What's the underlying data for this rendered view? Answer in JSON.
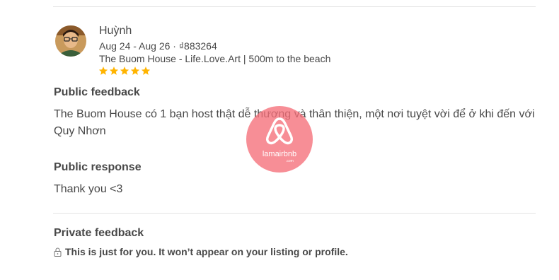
{
  "review": {
    "reviewer_name": "Huỳnh",
    "stay_info": "Aug 24 - Aug 26 · ₫883264",
    "listing": "The Buom House - Life.Love.Art | 500m to the beach",
    "rating": 5,
    "star_color": "#ffb400"
  },
  "public_feedback": {
    "title": "Public feedback",
    "text": "The Buom House có 1 bạn host thật dễ thương và thân thiện, một nơi tuyệt vời để ở khi đến với Quy Nhơn"
  },
  "public_response": {
    "title": "Public response",
    "text": "Thank you <3"
  },
  "private_feedback": {
    "title": "Private feedback",
    "note": "This is just for you. It won’t appear on your listing or profile.",
    "icon": "lock-icon"
  },
  "watermark": {
    "text": "lamairbnb",
    "sub": ".com",
    "color": "#f56e78"
  }
}
